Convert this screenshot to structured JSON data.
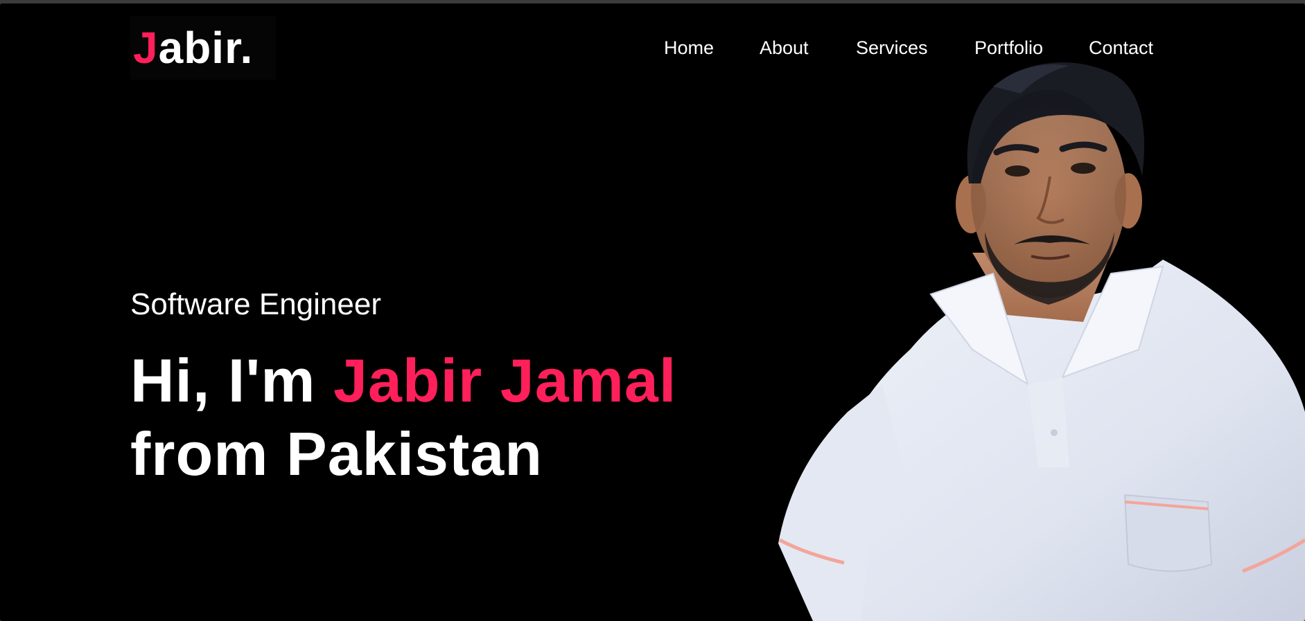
{
  "brand": {
    "logo_first": "J",
    "logo_rest": "abir",
    "logo_dot": ".",
    "accent_color": "#ff1f5a"
  },
  "nav": {
    "items": [
      "Home",
      "About",
      "Services",
      "Portfolio",
      "Contact"
    ]
  },
  "hero": {
    "subtitle": "Software Engineer",
    "greeting": "Hi, I'm ",
    "name": "Jabir Jamal",
    "location_line": "from Pakistan",
    "photo_icon": "person-portrait"
  }
}
